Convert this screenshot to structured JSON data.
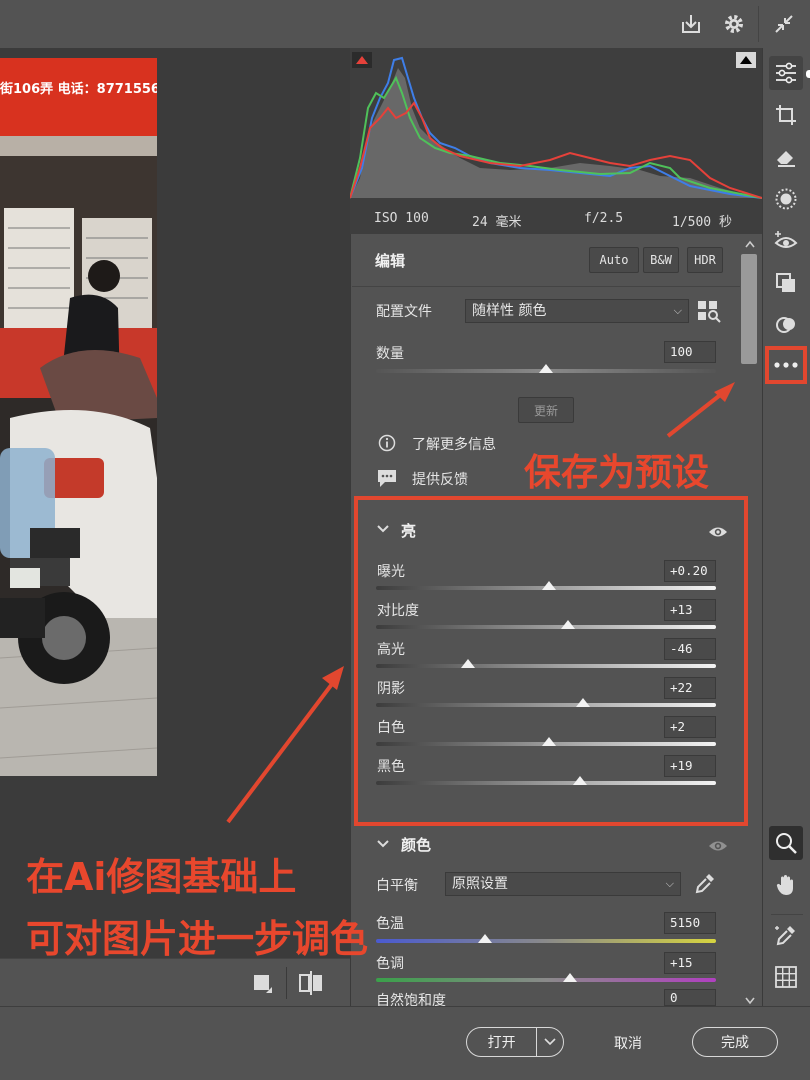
{
  "topbar": {
    "icons": [
      "download-icon",
      "gear-icon",
      "collapse-icon"
    ]
  },
  "photo": {
    "sign_text": "街106弄 电话：8771556"
  },
  "histogram": {
    "exif": {
      "iso": "ISO 100",
      "focal": "24 毫米",
      "aperture": "f/2.5",
      "shutter": "1/500 秒"
    }
  },
  "edit": {
    "title": "编辑",
    "auto_label": "Auto",
    "bw_label": "B&W",
    "hdr_label": "HDR",
    "profile_label": "配置文件",
    "profile_value": "随样性 颜色",
    "amount_label": "数量",
    "amount_value": "100",
    "amount_level": 0.5,
    "update_label": "更新",
    "learn_more": "了解更多信息",
    "feedback": "提供反馈"
  },
  "light": {
    "title": "亮",
    "sliders": [
      {
        "label": "曝光",
        "value": "+0.20",
        "level": 0.51
      },
      {
        "label": "对比度",
        "value": "+13",
        "level": 0.565
      },
      {
        "label": "高光",
        "value": "-46",
        "level": 0.27
      },
      {
        "label": "阴影",
        "value": "+22",
        "level": 0.61
      },
      {
        "label": "白色",
        "value": "+2",
        "level": 0.51
      },
      {
        "label": "黑色",
        "value": "+19",
        "level": 0.6
      }
    ]
  },
  "color": {
    "title": "颜色",
    "wb_label": "白平衡",
    "wb_value": "原照设置",
    "temp_label": "色温",
    "temp_value": "5150",
    "temp_level": 0.32,
    "tint_label": "色调",
    "tint_value": "+15",
    "tint_level": 0.57,
    "vibrance_label": "自然饱和度",
    "vibrance_value": "0"
  },
  "bottombar": {
    "open_label": "打开",
    "cancel_label": "取消",
    "done_label": "完成"
  },
  "annotations": {
    "save_preset": "保存为预设",
    "line1": "在Ai修图基础上",
    "line2": "可对图片进一步调色"
  },
  "colors": {
    "accent_red": "#e2472f",
    "panel_bg": "#535353"
  }
}
